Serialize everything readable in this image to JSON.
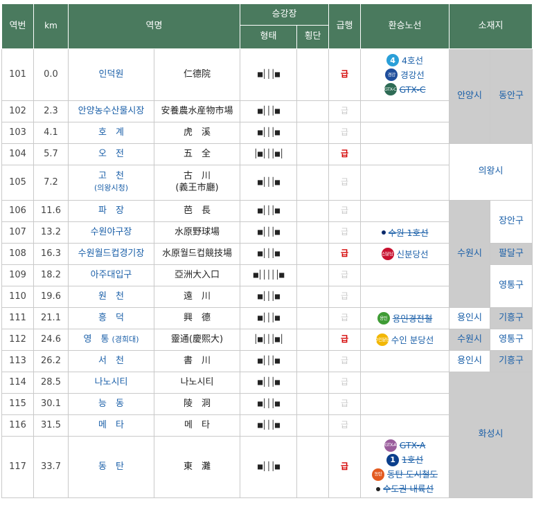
{
  "headers": {
    "no": "역번",
    "km": "km",
    "station_name": "역명",
    "platform": "승강장",
    "platform_type": "형태",
    "platform_cross": "횡단",
    "express": "급행",
    "transfer": "환승노선",
    "location": "소재지"
  },
  "rows": [
    {
      "no": "101",
      "km": "0.0",
      "name": "인덕원",
      "name_sub": "",
      "hanja": "仁德院",
      "hanja_sub": "",
      "platform": "■│││■",
      "express": "급",
      "express_on": true
    },
    {
      "no": "102",
      "km": "2.3",
      "name": "안양농수산물시장",
      "name_sub": "",
      "hanja": "安養農水産物市場",
      "hanja_sub": "",
      "platform": "■│││■",
      "express": "급",
      "express_on": false
    },
    {
      "no": "103",
      "km": "4.1",
      "name": "호　계",
      "name_sub": "",
      "hanja": "虎　溪",
      "hanja_sub": "",
      "platform": "■│││■",
      "express": "급",
      "express_on": false
    },
    {
      "no": "104",
      "km": "5.7",
      "name": "오　전",
      "name_sub": "",
      "hanja": "五　全",
      "hanja_sub": "",
      "platform": "│■│││■│",
      "express": "급",
      "express_on": true
    },
    {
      "no": "105",
      "km": "7.2",
      "name": "고　천",
      "name_sub": "(의왕시청)",
      "hanja": "古　川",
      "hanja_sub": "(義王市廳)",
      "platform": "■│││■",
      "express": "급",
      "express_on": false
    },
    {
      "no": "106",
      "km": "11.6",
      "name": "파　장",
      "name_sub": "",
      "hanja": "芭　長",
      "hanja_sub": "",
      "platform": "■│││■",
      "express": "급",
      "express_on": false
    },
    {
      "no": "107",
      "km": "13.2",
      "name": "수원야구장",
      "name_sub": "",
      "hanja": "水原野球場",
      "hanja_sub": "",
      "platform": "■│││■",
      "express": "급",
      "express_on": false
    },
    {
      "no": "108",
      "km": "16.3",
      "name": "수원월드컵경기장",
      "name_sub": "",
      "hanja": "水原월드컵競技場",
      "hanja_sub": "",
      "platform": "■│││■",
      "express": "급",
      "express_on": true
    },
    {
      "no": "109",
      "km": "18.2",
      "name": "아주대입구",
      "name_sub": "",
      "hanja": "亞洲大入口",
      "hanja_sub": "",
      "platform": "■│││││■",
      "express": "급",
      "express_on": false
    },
    {
      "no": "110",
      "km": "19.6",
      "name": "원　천",
      "name_sub": "",
      "hanja": "遠　川",
      "hanja_sub": "",
      "platform": "■│││■",
      "express": "급",
      "express_on": false
    },
    {
      "no": "111",
      "km": "21.1",
      "name": "흥　덕",
      "name_sub": "",
      "hanja": "興　德",
      "hanja_sub": "",
      "platform": "■│││■",
      "express": "급",
      "express_on": false
    },
    {
      "no": "112",
      "km": "24.6",
      "name": "영　통",
      "name_sub": "(경희대)",
      "hanja": "靈通(慶熙大)",
      "hanja_sub": "",
      "platform": "│■│││■│",
      "express": "급",
      "express_on": true
    },
    {
      "no": "113",
      "km": "26.2",
      "name": "서　천",
      "name_sub": "",
      "hanja": "書　川",
      "hanja_sub": "",
      "platform": "■│││■",
      "express": "급",
      "express_on": false
    },
    {
      "no": "114",
      "km": "28.5",
      "name": "나노시티",
      "name_sub": "",
      "hanja": "나노시티",
      "hanja_sub": "",
      "platform": "■│││■",
      "express": "급",
      "express_on": false
    },
    {
      "no": "115",
      "km": "30.1",
      "name": "능　동",
      "name_sub": "",
      "hanja": "陵　洞",
      "hanja_sub": "",
      "platform": "■│││■",
      "express": "급",
      "express_on": false
    },
    {
      "no": "116",
      "km": "31.5",
      "name": "메　타",
      "name_sub": "",
      "hanja": "메　타",
      "hanja_sub": "",
      "platform": "■│││■",
      "express": "급",
      "express_on": false
    },
    {
      "no": "117",
      "km": "33.7",
      "name": "동　탄",
      "name_sub": "",
      "hanja": "東　灘",
      "hanja_sub": "",
      "platform": "■│││■",
      "express": "급",
      "express_on": true
    }
  ],
  "transfers": {
    "r101": [
      {
        "badge": "4",
        "badge_color": "#2a9fd8",
        "badge_icon": "line-4-badge",
        "label": "4호선",
        "strike": false
      },
      {
        "badge": "경강",
        "badge_color": "#1f4e9c",
        "badge_icon": "gyeonggang-badge",
        "label": "경강선",
        "strike": false
      },
      {
        "badge": "GTX-C",
        "badge_color": "#2e6b55",
        "badge_icon": "gtx-c-badge",
        "label": "GTX-C",
        "strike": true
      }
    ],
    "r107": [
      {
        "badge": "",
        "badge_color": "#0b2a6b",
        "badge_icon": "line-1-dot",
        "label": "수원 1호선",
        "strike": true
      }
    ],
    "r108": [
      {
        "badge": "신분당",
        "badge_color": "#c8102e",
        "badge_icon": "sinbundang-badge",
        "label": "신분당선",
        "strike": false
      }
    ],
    "r111": [
      {
        "badge": "용인",
        "badge_color": "#3f9c35",
        "badge_icon": "yongin-badge",
        "label": "용인경전철",
        "strike": true
      }
    ],
    "r112": [
      {
        "badge": "수인분당",
        "badge_color": "#f2b705",
        "badge_icon": "suin-bundang-badge",
        "label": "수인 분당선",
        "strike": false
      }
    ],
    "r117": [
      {
        "badge": "GTX-A",
        "badge_color": "#9a5d9c",
        "badge_icon": "gtx-a-badge",
        "label": "GTX-A",
        "strike": true
      },
      {
        "badge": "1",
        "badge_color": "#0b3f8c",
        "badge_icon": "line-1-badge",
        "label": "1호선",
        "strike": true
      },
      {
        "badge": "동탄",
        "badge_color": "#e35a1f",
        "badge_icon": "dongtan-tram-badge",
        "label": "동탄 도시철도",
        "strike": true
      },
      {
        "badge": "",
        "badge_color": "#222222",
        "badge_icon": "metropolitan-dot",
        "label": "수도권 내륙선",
        "strike": true
      }
    ]
  },
  "locations": {
    "anyang": "안양시",
    "dongan": "동안구",
    "uiwang": "의왕시",
    "suwon_a": "수원시",
    "jangan": "장안구",
    "paldal": "팔달구",
    "yeongtong_a": "영통구",
    "yongin_a": "용인시",
    "giheung_a": "기흥구",
    "suwon_b": "수원시",
    "yeongtong_b": "영통구",
    "yongin_b": "용인시",
    "giheung_b": "기흥구",
    "hwaseong": "화성시"
  }
}
